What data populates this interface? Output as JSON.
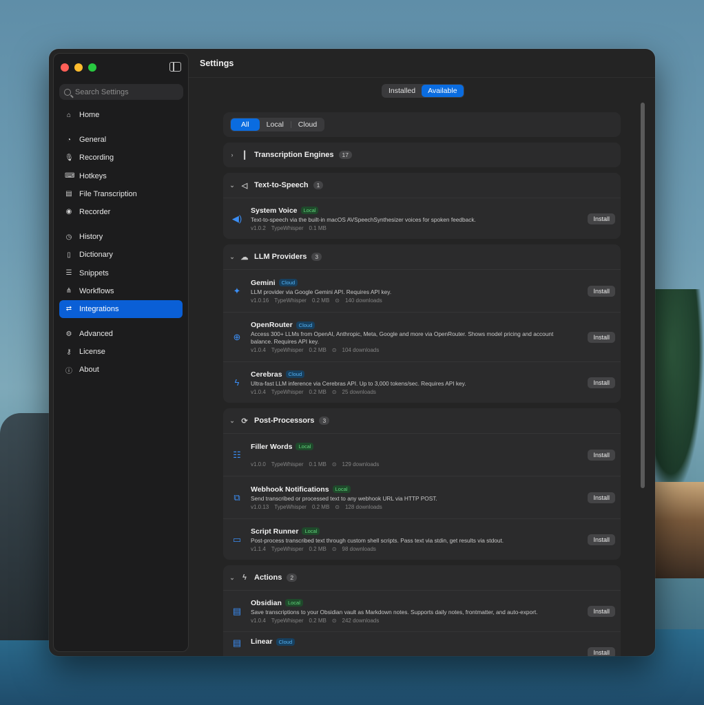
{
  "app": {
    "title": "Settings"
  },
  "search": {
    "placeholder": "Search Settings"
  },
  "sidebar": {
    "items": [
      {
        "label": "Home",
        "icon": "home-icon"
      },
      {
        "label": "General",
        "icon": "gauge-icon"
      },
      {
        "label": "Recording",
        "icon": "microphone-icon"
      },
      {
        "label": "Hotkeys",
        "icon": "keyboard-icon"
      },
      {
        "label": "File Transcription",
        "icon": "document-icon"
      },
      {
        "label": "Recorder",
        "icon": "record-icon"
      },
      {
        "label": "History",
        "icon": "clock-icon"
      },
      {
        "label": "Dictionary",
        "icon": "book-icon"
      },
      {
        "label": "Snippets",
        "icon": "snippets-icon"
      },
      {
        "label": "Workflows",
        "icon": "workflow-icon"
      },
      {
        "label": "Integrations",
        "icon": "integrations-icon",
        "active": true
      },
      {
        "label": "Advanced",
        "icon": "gears-icon"
      },
      {
        "label": "License",
        "icon": "key-icon"
      },
      {
        "label": "About",
        "icon": "info-icon"
      }
    ]
  },
  "top_tabs": [
    "Installed",
    "Available"
  ],
  "filter_tabs": [
    "All",
    "Local",
    "Cloud"
  ],
  "sections": {
    "transcription": {
      "title": "Transcription Engines",
      "count": "17"
    },
    "tts": {
      "title": "Text-to-Speech",
      "count": "1",
      "items": [
        {
          "name": "System Voice",
          "badge": "Local",
          "desc": "Text-to-speech via the built-in macOS AVSpeechSynthesizer voices for spoken feedback.",
          "version": "v1.0.2",
          "author": "TypeWhisper",
          "size": "0.1 MB",
          "action": "Install"
        }
      ]
    },
    "llm": {
      "title": "LLM Providers",
      "count": "3",
      "items": [
        {
          "name": "Gemini",
          "badge": "Cloud",
          "desc": "LLM provider via Google Gemini API. Requires API key.",
          "version": "v1.0.16",
          "author": "TypeWhisper",
          "size": "0.2 MB",
          "downloads": "140 downloads",
          "action": "Install"
        },
        {
          "name": "OpenRouter",
          "badge": "Cloud",
          "desc": "Access 300+ LLMs from OpenAI, Anthropic, Meta, Google and more via OpenRouter. Shows model pricing and account balance. Requires API key.",
          "version": "v1.0.4",
          "author": "TypeWhisper",
          "size": "0.2 MB",
          "downloads": "104 downloads",
          "action": "Install"
        },
        {
          "name": "Cerebras",
          "badge": "Cloud",
          "desc": "Ultra-fast LLM inference via Cerebras API. Up to 3,000 tokens/sec. Requires API key.",
          "version": "v1.0.4",
          "author": "TypeWhisper",
          "size": "0.2 MB",
          "downloads": "25 downloads",
          "action": "Install"
        }
      ]
    },
    "post": {
      "title": "Post-Processors",
      "count": "3",
      "items": [
        {
          "name": "Filler Words",
          "badge": "Local",
          "desc": "",
          "version": "v1.0.0",
          "author": "TypeWhisper",
          "size": "0.1 MB",
          "downloads": "129 downloads",
          "action": "Install"
        },
        {
          "name": "Webhook Notifications",
          "badge": "Local",
          "desc": "Send transcribed or processed text to any webhook URL via HTTP POST.",
          "version": "v1.0.13",
          "author": "TypeWhisper",
          "size": "0.2 MB",
          "downloads": "128 downloads",
          "action": "Install"
        },
        {
          "name": "Script Runner",
          "badge": "Local",
          "desc": "Post-process transcribed text through custom shell scripts. Pass text via stdin, get results via stdout.",
          "version": "v1.1.4",
          "author": "TypeWhisper",
          "size": "0.2 MB",
          "downloads": "98 downloads",
          "action": "Install"
        }
      ]
    },
    "actions": {
      "title": "Actions",
      "count": "2",
      "items": [
        {
          "name": "Obsidian",
          "badge": "Local",
          "desc": "Save transcriptions to your Obsidian vault as Markdown notes. Supports daily notes, frontmatter, and auto-export.",
          "version": "v1.0.4",
          "author": "TypeWhisper",
          "size": "0.2 MB",
          "downloads": "242 downloads",
          "action": "Install"
        },
        {
          "name": "Linear",
          "badge": "Cloud",
          "action": "Install"
        }
      ]
    }
  },
  "colors": {
    "accent": "#0a6ce0",
    "local_badge": "#5fd37a",
    "cloud_badge": "#55b2f2"
  }
}
